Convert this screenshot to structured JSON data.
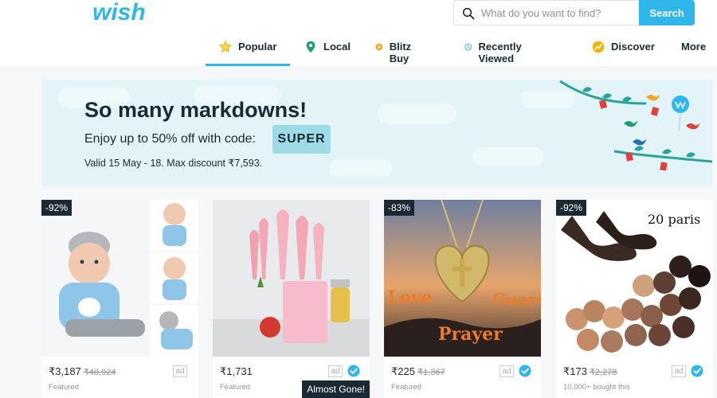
{
  "brand": {
    "name": "wish"
  },
  "search": {
    "placeholder": "What do you want to find?",
    "button_label": "Search"
  },
  "nav": {
    "items": [
      {
        "label": "Popular",
        "icon": "star-icon",
        "active": true
      },
      {
        "label": "Local",
        "icon": "location-pin-icon"
      },
      {
        "label": "Blitz Buy",
        "icon": "blitz-buy-icon"
      },
      {
        "label": "Recently Viewed",
        "icon": "clock-icon"
      },
      {
        "label": "Discover",
        "icon": "discover-icon"
      },
      {
        "label": "More"
      }
    ]
  },
  "banner": {
    "headline": "So many markdowns!",
    "promo_text": "Enjoy up to 50% off with code:",
    "code": "SUPER",
    "valid_text": "Valid 15 May - 18. Max discount ₹7,593."
  },
  "products": [
    {
      "discount": "-92%",
      "price": "₹3,187",
      "old_price": "₹40,924",
      "ad": "ad",
      "meta": "Featured",
      "image": "reborn-baby-doll"
    },
    {
      "price": "₹1,731",
      "ad": "ad",
      "verified": true,
      "badge": "Almost Gone!",
      "meta": "Featured",
      "image": "pink-kitchen-utensils"
    },
    {
      "discount": "-83%",
      "price": "₹225",
      "old_price": "₹1,367",
      "ad": "ad",
      "verified": true,
      "meta": "Featured",
      "image": "heart-cross-necklace",
      "image_text": [
        "Love",
        "Guard",
        "Prayer"
      ]
    },
    {
      "discount": "-92%",
      "price": "₹173",
      "old_price": "₹2,278",
      "ad": "ad",
      "verified": true,
      "meta": "10,000+ bought this",
      "image": "sheer-socks",
      "image_text": [
        "20 paris"
      ]
    }
  ],
  "colors": {
    "accent": "#2fb7ec",
    "text": "#192a32",
    "banner_bg": "#e3f4f8",
    "code_badge": "#9fdbe6"
  }
}
